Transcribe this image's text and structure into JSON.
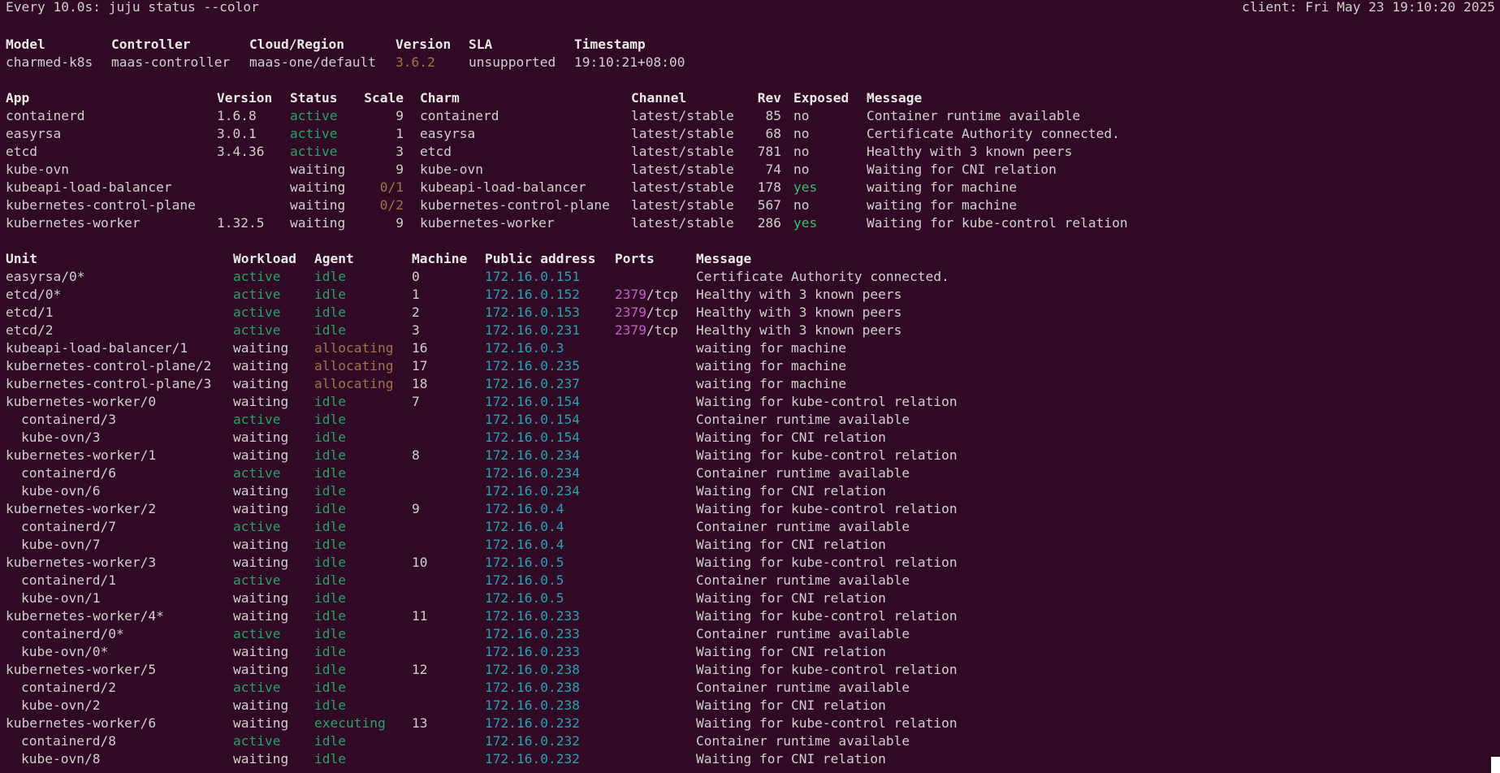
{
  "header": {
    "command": "Every 10.0s: juju status --color",
    "client": "client: Fri May 23 19:10:20 2025"
  },
  "model_table": {
    "headers": [
      "Model",
      "Controller",
      "Cloud/Region",
      "Version",
      "SLA",
      "Timestamp"
    ],
    "row": {
      "model": "charmed-k8s",
      "controller": "maas-controller",
      "cloud": "maas-one/default",
      "version": "3.6.2",
      "sla": "unsupported",
      "timestamp": "19:10:21+08:00"
    }
  },
  "app_table": {
    "headers": [
      "App",
      "Version",
      "Status",
      "Scale",
      "Charm",
      "Channel",
      "Rev",
      "Exposed",
      "Message"
    ],
    "rows": [
      {
        "app": "containerd",
        "version": "1.6.8",
        "status": "active",
        "scale": "9",
        "charm": "containerd",
        "channel": "latest/stable",
        "rev": "85",
        "exposed": "no",
        "message": "Container runtime available"
      },
      {
        "app": "easyrsa",
        "version": "3.0.1",
        "status": "active",
        "scale": "1",
        "charm": "easyrsa",
        "channel": "latest/stable",
        "rev": "68",
        "exposed": "no",
        "message": "Certificate Authority connected."
      },
      {
        "app": "etcd",
        "version": "3.4.36",
        "status": "active",
        "scale": "3",
        "charm": "etcd",
        "channel": "latest/stable",
        "rev": "781",
        "exposed": "no",
        "message": "Healthy with 3 known peers"
      },
      {
        "app": "kube-ovn",
        "version": "",
        "status": "waiting",
        "scale": "9",
        "charm": "kube-ovn",
        "channel": "latest/stable",
        "rev": "74",
        "exposed": "no",
        "message": "Waiting for CNI relation"
      },
      {
        "app": "kubeapi-load-balancer",
        "version": "",
        "status": "waiting",
        "scale": "0/1",
        "charm": "kubeapi-load-balancer",
        "channel": "latest/stable",
        "rev": "178",
        "exposed": "yes",
        "message": "waiting for machine"
      },
      {
        "app": "kubernetes-control-plane",
        "version": "",
        "status": "waiting",
        "scale": "0/2",
        "charm": "kubernetes-control-plane",
        "channel": "latest/stable",
        "rev": "567",
        "exposed": "no",
        "message": "waiting for machine"
      },
      {
        "app": "kubernetes-worker",
        "version": "1.32.5",
        "status": "waiting",
        "scale": "9",
        "charm": "kubernetes-worker",
        "channel": "latest/stable",
        "rev": "286",
        "exposed": "yes",
        "message": "Waiting for kube-control relation"
      }
    ]
  },
  "unit_table": {
    "headers": [
      "Unit",
      "Workload",
      "Agent",
      "Machine",
      "Public address",
      "Ports",
      "Message"
    ],
    "rows": [
      {
        "unit": "easyrsa/0*",
        "sub": false,
        "workload": "active",
        "agent": "idle",
        "machine": "0",
        "address": "172.16.0.151",
        "port": "",
        "proto": "",
        "message": "Certificate Authority connected."
      },
      {
        "unit": "etcd/0*",
        "sub": false,
        "workload": "active",
        "agent": "idle",
        "machine": "1",
        "address": "172.16.0.152",
        "port": "2379",
        "proto": "/tcp",
        "message": "Healthy with 3 known peers"
      },
      {
        "unit": "etcd/1",
        "sub": false,
        "workload": "active",
        "agent": "idle",
        "machine": "2",
        "address": "172.16.0.153",
        "port": "2379",
        "proto": "/tcp",
        "message": "Healthy with 3 known peers"
      },
      {
        "unit": "etcd/2",
        "sub": false,
        "workload": "active",
        "agent": "idle",
        "machine": "3",
        "address": "172.16.0.231",
        "port": "2379",
        "proto": "/tcp",
        "message": "Healthy with 3 known peers"
      },
      {
        "unit": "kubeapi-load-balancer/1",
        "sub": false,
        "workload": "waiting",
        "agent": "allocating",
        "machine": "16",
        "address": "172.16.0.3",
        "port": "",
        "proto": "",
        "message": "waiting for machine"
      },
      {
        "unit": "kubernetes-control-plane/2",
        "sub": false,
        "workload": "waiting",
        "agent": "allocating",
        "machine": "17",
        "address": "172.16.0.235",
        "port": "",
        "proto": "",
        "message": "waiting for machine"
      },
      {
        "unit": "kubernetes-control-plane/3",
        "sub": false,
        "workload": "waiting",
        "agent": "allocating",
        "machine": "18",
        "address": "172.16.0.237",
        "port": "",
        "proto": "",
        "message": "waiting for machine"
      },
      {
        "unit": "kubernetes-worker/0",
        "sub": false,
        "workload": "waiting",
        "agent": "idle",
        "machine": "7",
        "address": "172.16.0.154",
        "port": "",
        "proto": "",
        "message": "Waiting for kube-control relation"
      },
      {
        "unit": "containerd/3",
        "sub": true,
        "workload": "active",
        "agent": "idle",
        "machine": "",
        "address": "172.16.0.154",
        "port": "",
        "proto": "",
        "message": "Container runtime available"
      },
      {
        "unit": "kube-ovn/3",
        "sub": true,
        "workload": "waiting",
        "agent": "idle",
        "machine": "",
        "address": "172.16.0.154",
        "port": "",
        "proto": "",
        "message": "Waiting for CNI relation"
      },
      {
        "unit": "kubernetes-worker/1",
        "sub": false,
        "workload": "waiting",
        "agent": "idle",
        "machine": "8",
        "address": "172.16.0.234",
        "port": "",
        "proto": "",
        "message": "Waiting for kube-control relation"
      },
      {
        "unit": "containerd/6",
        "sub": true,
        "workload": "active",
        "agent": "idle",
        "machine": "",
        "address": "172.16.0.234",
        "port": "",
        "proto": "",
        "message": "Container runtime available"
      },
      {
        "unit": "kube-ovn/6",
        "sub": true,
        "workload": "waiting",
        "agent": "idle",
        "machine": "",
        "address": "172.16.0.234",
        "port": "",
        "proto": "",
        "message": "Waiting for CNI relation"
      },
      {
        "unit": "kubernetes-worker/2",
        "sub": false,
        "workload": "waiting",
        "agent": "idle",
        "machine": "9",
        "address": "172.16.0.4",
        "port": "",
        "proto": "",
        "message": "Waiting for kube-control relation"
      },
      {
        "unit": "containerd/7",
        "sub": true,
        "workload": "active",
        "agent": "idle",
        "machine": "",
        "address": "172.16.0.4",
        "port": "",
        "proto": "",
        "message": "Container runtime available"
      },
      {
        "unit": "kube-ovn/7",
        "sub": true,
        "workload": "waiting",
        "agent": "idle",
        "machine": "",
        "address": "172.16.0.4",
        "port": "",
        "proto": "",
        "message": "Waiting for CNI relation"
      },
      {
        "unit": "kubernetes-worker/3",
        "sub": false,
        "workload": "waiting",
        "agent": "idle",
        "machine": "10",
        "address": "172.16.0.5",
        "port": "",
        "proto": "",
        "message": "Waiting for kube-control relation"
      },
      {
        "unit": "containerd/1",
        "sub": true,
        "workload": "active",
        "agent": "idle",
        "machine": "",
        "address": "172.16.0.5",
        "port": "",
        "proto": "",
        "message": "Container runtime available"
      },
      {
        "unit": "kube-ovn/1",
        "sub": true,
        "workload": "waiting",
        "agent": "idle",
        "machine": "",
        "address": "172.16.0.5",
        "port": "",
        "proto": "",
        "message": "Waiting for CNI relation"
      },
      {
        "unit": "kubernetes-worker/4*",
        "sub": false,
        "workload": "waiting",
        "agent": "idle",
        "machine": "11",
        "address": "172.16.0.233",
        "port": "",
        "proto": "",
        "message": "Waiting for kube-control relation"
      },
      {
        "unit": "containerd/0*",
        "sub": true,
        "workload": "active",
        "agent": "idle",
        "machine": "",
        "address": "172.16.0.233",
        "port": "",
        "proto": "",
        "message": "Container runtime available"
      },
      {
        "unit": "kube-ovn/0*",
        "sub": true,
        "workload": "waiting",
        "agent": "idle",
        "machine": "",
        "address": "172.16.0.233",
        "port": "",
        "proto": "",
        "message": "Waiting for CNI relation"
      },
      {
        "unit": "kubernetes-worker/5",
        "sub": false,
        "workload": "waiting",
        "agent": "idle",
        "machine": "12",
        "address": "172.16.0.238",
        "port": "",
        "proto": "",
        "message": "Waiting for kube-control relation"
      },
      {
        "unit": "containerd/2",
        "sub": true,
        "workload": "active",
        "agent": "idle",
        "machine": "",
        "address": "172.16.0.238",
        "port": "",
        "proto": "",
        "message": "Container runtime available"
      },
      {
        "unit": "kube-ovn/2",
        "sub": true,
        "workload": "waiting",
        "agent": "idle",
        "machine": "",
        "address": "172.16.0.238",
        "port": "",
        "proto": "",
        "message": "Waiting for CNI relation"
      },
      {
        "unit": "kubernetes-worker/6",
        "sub": false,
        "workload": "waiting",
        "agent": "executing",
        "machine": "13",
        "address": "172.16.0.232",
        "port": "",
        "proto": "",
        "message": "Waiting for kube-control relation"
      },
      {
        "unit": "containerd/8",
        "sub": true,
        "workload": "active",
        "agent": "idle",
        "machine": "",
        "address": "172.16.0.232",
        "port": "",
        "proto": "",
        "message": "Container runtime available"
      },
      {
        "unit": "kube-ovn/8",
        "sub": true,
        "workload": "waiting",
        "agent": "idle",
        "machine": "",
        "address": "172.16.0.232",
        "port": "",
        "proto": "",
        "message": "Waiting for CNI relation"
      }
    ]
  },
  "colors": {
    "background": "#300a24",
    "text": "#d0cfcc",
    "active": "#26a269",
    "allocating": "#a2734c",
    "address": "#2aa1b3",
    "port": "#c061cb"
  }
}
